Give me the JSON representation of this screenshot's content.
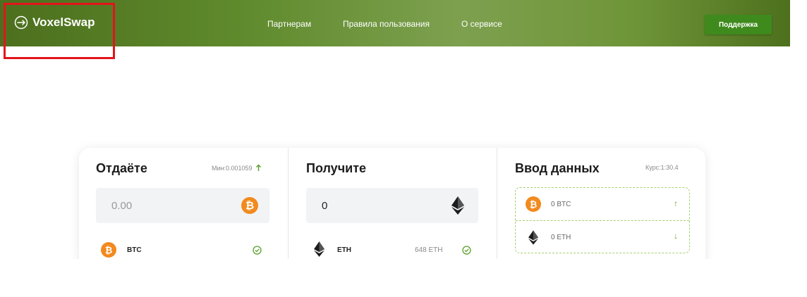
{
  "header": {
    "logo_text": "VoxelSwap",
    "nav": [
      "Партнерам",
      "Правила пользования",
      "О сервисе"
    ],
    "support_label": "Поддержка"
  },
  "give": {
    "title": "Отдаёте",
    "min_label": "Мин:0.001059",
    "amount_placeholder": "0.00",
    "coin": "BTC"
  },
  "receive": {
    "title": "Получите",
    "amount": "0",
    "coin": "ETH",
    "reserve": "648 ETH"
  },
  "details": {
    "title": "Ввод данных",
    "rate": "Курс:1:30.4",
    "rows": [
      "0 BTC",
      "0 ETH"
    ]
  },
  "colors": {
    "accent": "#5f8a2c",
    "support_button": "#3f8a1d",
    "btc": "#f28a1e",
    "dashed_border": "#a7cf72",
    "highlight": "#e3141c"
  },
  "icons": [
    "swap-circle-icon",
    "bitcoin-icon",
    "ethereum-icon",
    "check-circle-icon",
    "arrow-up-icon",
    "arrow-down-icon"
  ]
}
